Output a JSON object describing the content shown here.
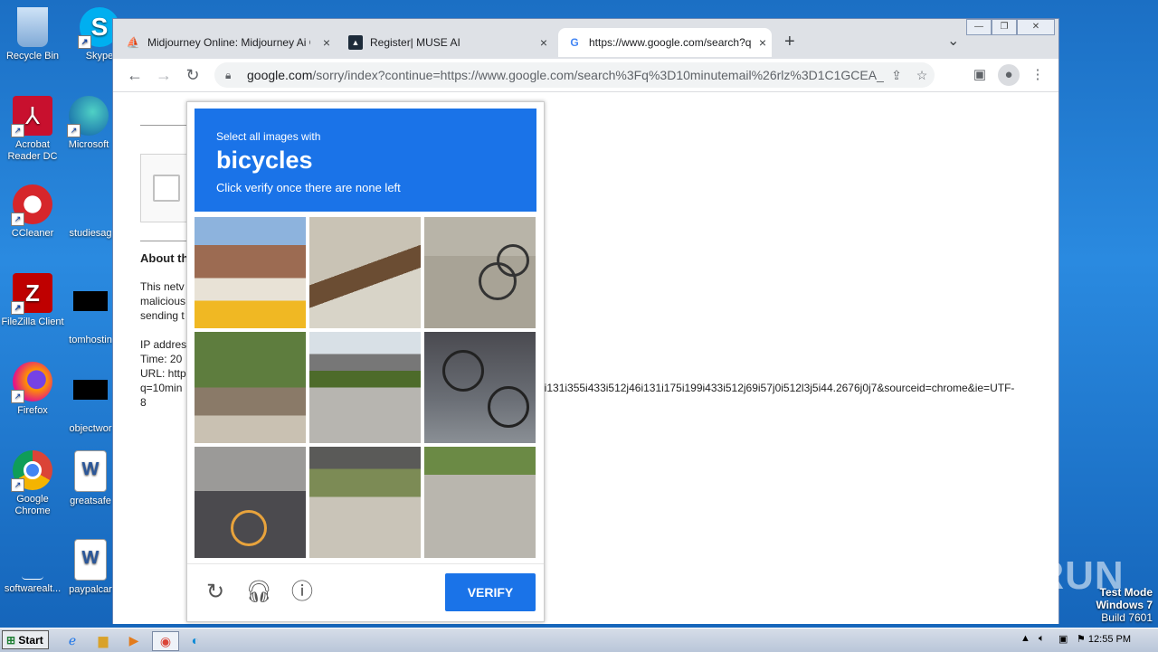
{
  "desktop": {
    "icons": [
      {
        "label": "Recycle Bin"
      },
      {
        "label": "Skype"
      },
      {
        "label": "Acrobat Reader DC"
      },
      {
        "label": "Microsoft"
      },
      {
        "label": "CCleaner"
      },
      {
        "label": "studiesag"
      },
      {
        "label": "FileZilla Client"
      },
      {
        "label": "tomhostin"
      },
      {
        "label": "Firefox"
      },
      {
        "label": "objectwor"
      },
      {
        "label": "Google Chrome"
      },
      {
        "label": "greatsafe"
      },
      {
        "label": "softwarealt..."
      },
      {
        "label": "paypalcar"
      }
    ]
  },
  "browser": {
    "tabs": [
      {
        "title": "Midjourney Online: Midjourney Ai On",
        "close": "×"
      },
      {
        "title": "Register| MUSE AI",
        "close": "×"
      },
      {
        "title": "https://www.google.com/search?q=",
        "close": "×"
      }
    ],
    "new_tab": "+",
    "tab_menu": "⌄",
    "window_controls": {
      "minimize": "—",
      "restore": "❐",
      "close": "✕"
    },
    "nav": {
      "back": "←",
      "forward": "→",
      "reload": "↻"
    },
    "address": {
      "host": "google.com",
      "path": "/sorry/index?continue=https://www.google.com/search%3Fq%3D10minutemail%26rlz%3D1C1GCEA_..."
    }
  },
  "page": {
    "about_heading": "About th",
    "para_lines": [
      "This netv",
      "malicious",
      "sending t"
    ],
    "ip_lines": [
      "IP addres",
      "Time: 20",
      "URL: http",
      "q=10min",
      "8"
    ],
    "url_tail": "0i131i355i433i512j46i131i175i199i433i512j69i57j0i512l3j5i44.2676j0j7&sourceid=chrome&ie=UTF-"
  },
  "captcha": {
    "instruction_small": "Select all images with",
    "target": "bicycles",
    "instruction_sub": "Click verify once there are none left",
    "verify_label": "VERIFY",
    "tiles": [
      {
        "name": "tile-1"
      },
      {
        "name": "tile-2"
      },
      {
        "name": "tile-3"
      },
      {
        "name": "tile-4"
      },
      {
        "name": "tile-5"
      },
      {
        "name": "tile-6"
      },
      {
        "name": "tile-7"
      },
      {
        "name": "tile-8"
      },
      {
        "name": "tile-9"
      }
    ]
  },
  "watermark": "ANY RUN",
  "system": {
    "test_mode": "Test Mode",
    "os": "Windows 7",
    "build": "Build 7601",
    "clock": "12:55 PM",
    "start": "Start"
  }
}
